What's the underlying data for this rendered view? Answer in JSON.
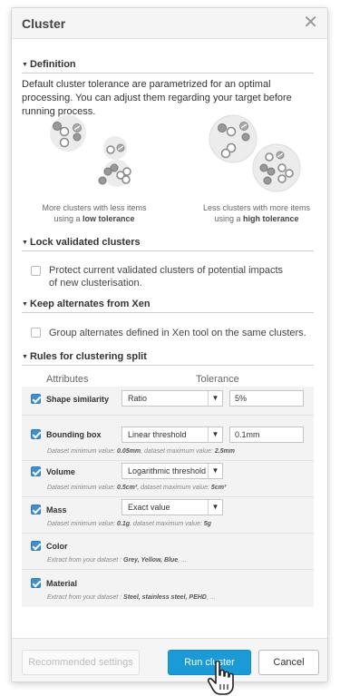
{
  "dialog": {
    "title": "Cluster"
  },
  "definition": {
    "heading": "Definition",
    "text": "Default cluster tolerance are parametrized for an optimal processing. You can adjust them regarding your target before running process.",
    "low": {
      "line1": "More clusters with less items",
      "line2_prefix": "using a ",
      "line2_bold": "low tolerance"
    },
    "high": {
      "line1": "Less clusters with more items",
      "line2_prefix": "using a ",
      "line2_bold": "high tolerance"
    }
  },
  "lock": {
    "heading": "Lock validated clusters",
    "line1": "Protect current validated clusters of potential impacts",
    "line2": "of new clusterisation.",
    "checked": false
  },
  "alternates": {
    "heading": "Keep alternates from Xen",
    "label": "Group alternates defined in Xen tool on the same clusters.",
    "checked": false
  },
  "rules": {
    "heading": "Rules for clustering split",
    "col_attributes": "Attributes",
    "col_tolerance": "Tolerance",
    "items": [
      {
        "label": "Shape similarity",
        "select": "Ratio",
        "input": "5%",
        "checked": true
      },
      {
        "label": "Bounding box",
        "select": "Linear threshold",
        "input": "0.1mm",
        "checked": true,
        "note_prefix": "Dataset minimum value: ",
        "note_min": "0.05mm",
        "note_mid": ", dataset maximum value: ",
        "note_max": "2.5mm"
      },
      {
        "label": "Volume",
        "select": "Logarithmic threshold",
        "checked": true,
        "note_prefix": "Dataset minimum value: ",
        "note_min": "0.5cm³",
        "note_mid": ", dataset maximum value: ",
        "note_max": "5cm³"
      },
      {
        "label": "Mass",
        "select": "Exact value",
        "checked": true,
        "note_prefix": "Dataset minimum value: ",
        "note_min": "0.1g",
        "note_mid": ", dataset maximum value: ",
        "note_max": "5g"
      },
      {
        "label": "Color",
        "checked": true,
        "note_prefix": "Extract from your dataset : ",
        "note_values": "Grey, Yellow, Blue",
        "note_suffix": ", ..."
      },
      {
        "label": "Material",
        "checked": true,
        "note_prefix": "Extract from your dataset : ",
        "note_values": "Steel, stainless steel, PEHD",
        "note_suffix": ", ..."
      }
    ]
  },
  "footer": {
    "recommended": "Recommended settings",
    "run": "Run cluster",
    "cancel": "Cancel"
  },
  "colors": {
    "accent": "#1a9ad6",
    "checkbox": "#3d8fd1"
  },
  "icons": {
    "close": "close-icon",
    "caret": "caret-down-icon",
    "select_arrow": "triangle-down-icon",
    "cursor": "hand-pointer-icon"
  }
}
